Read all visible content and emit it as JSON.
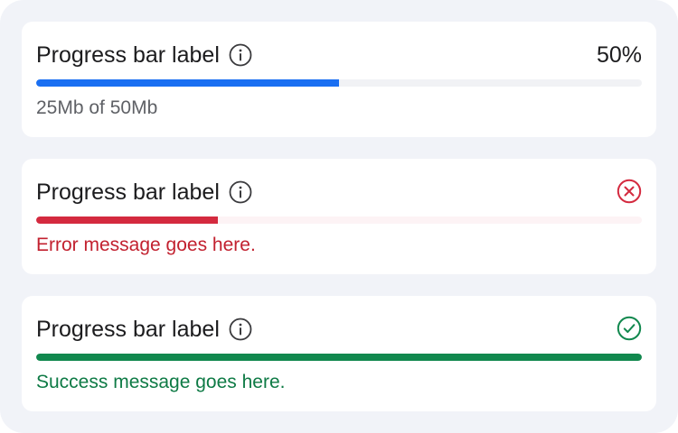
{
  "colors": {
    "background": "#f1f3f8",
    "card": "#ffffff",
    "text": "#1c1c1e",
    "neutral": "#5f6166",
    "progress_blue": "#1a6ff2",
    "error_red": "#d42a3f",
    "success_green": "#11884e"
  },
  "progress_bars": [
    {
      "label": "Progress bar label",
      "info_icon": "info-icon",
      "percent_text": "50%",
      "progress": 0.5,
      "message": "25Mb of 50Mb",
      "state": "default"
    },
    {
      "label": "Progress bar label",
      "info_icon": "info-icon",
      "status_icon": "error-circle-x-icon",
      "progress": 0.3,
      "message": "Error message goes here.",
      "state": "error"
    },
    {
      "label": "Progress bar label",
      "info_icon": "info-icon",
      "status_icon": "success-circle-check-icon",
      "progress": 1.0,
      "message": "Success message goes here.",
      "state": "success"
    }
  ]
}
